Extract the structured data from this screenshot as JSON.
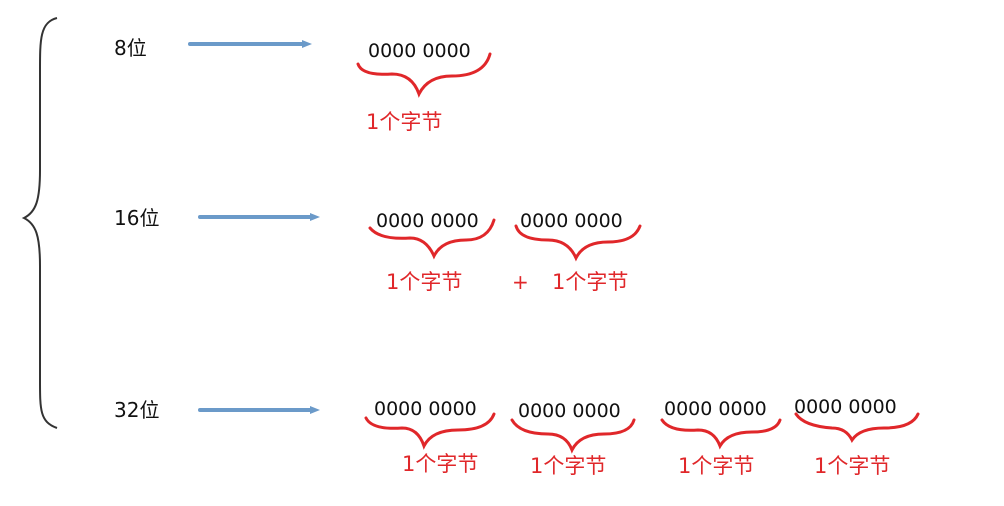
{
  "colors": {
    "arrow": "#6b9ac9",
    "brace": "#333333",
    "annotation": "#e0272a",
    "text": "#111111"
  },
  "rows": [
    {
      "label": "8位",
      "groups": [
        {
          "bits": "0000 0000",
          "byte_label": "1个字节"
        }
      ]
    },
    {
      "label": "16位",
      "groups": [
        {
          "bits": "0000 0000",
          "byte_label": "1个字节"
        },
        {
          "bits": "0000 0000",
          "byte_label": "1个字节"
        }
      ],
      "separator": "+"
    },
    {
      "label": "32位",
      "groups": [
        {
          "bits": "0000 0000",
          "byte_label": "1个字节"
        },
        {
          "bits": "0000 0000",
          "byte_label": "1个字节"
        },
        {
          "bits": "0000 0000",
          "byte_label": "1个字节"
        },
        {
          "bits": "0000 0000",
          "byte_label": "1个字节"
        }
      ]
    }
  ]
}
